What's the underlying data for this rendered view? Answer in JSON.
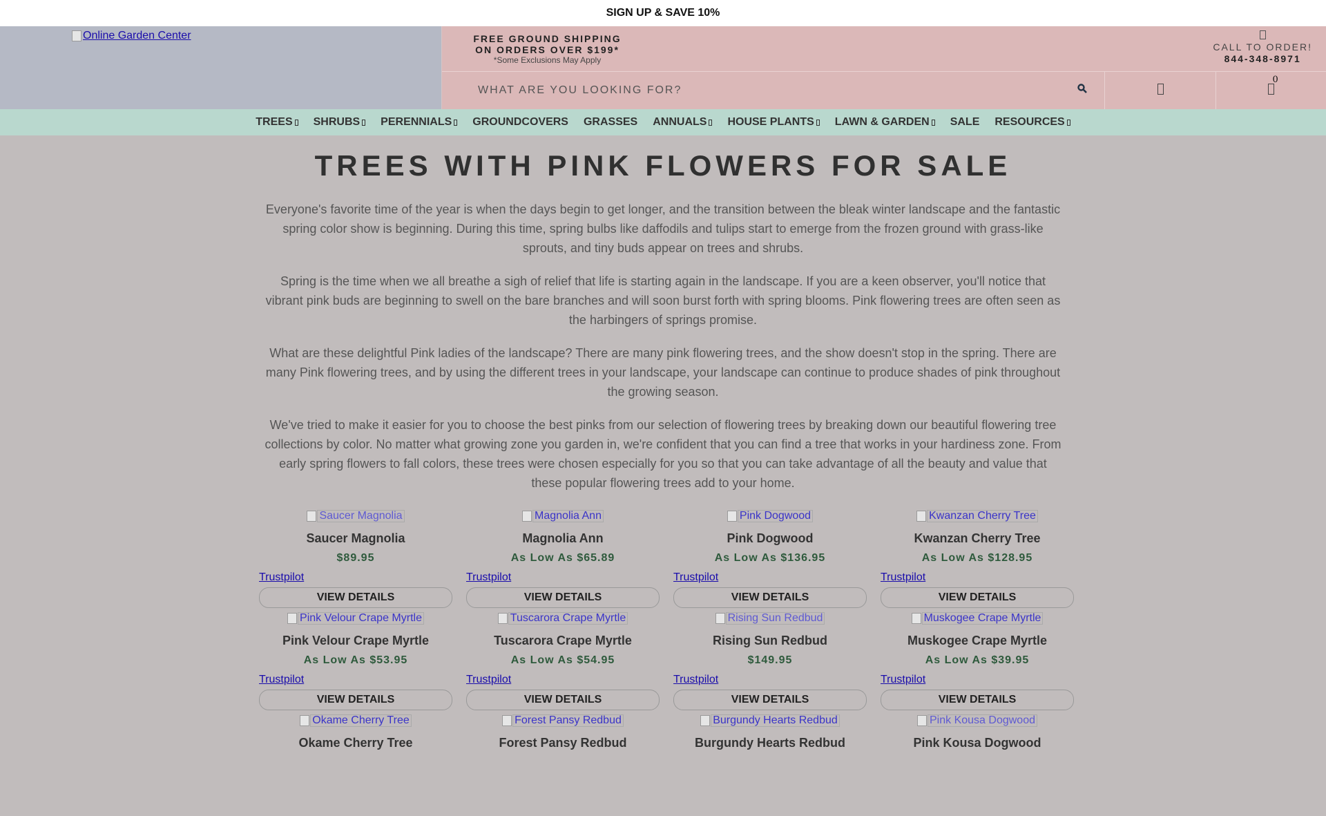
{
  "topbar": {
    "text": "SIGN UP & SAVE 10%"
  },
  "header": {
    "logo_alt": "Online Garden Center",
    "shipping_line1": "FREE GROUND SHIPPING",
    "shipping_line2": "ON ORDERS OVER $199*",
    "shipping_note": "*Some Exclusions May Apply",
    "call_label": "CALL TO ORDER!",
    "phone": "844-348-8971",
    "search_placeholder": "WHAT ARE YOU LOOKING FOR?",
    "cart_count": "0"
  },
  "nav": [
    {
      "label": "TREES",
      "dropdown": true
    },
    {
      "label": "SHRUBS",
      "dropdown": true
    },
    {
      "label": "PERENNIALS",
      "dropdown": true
    },
    {
      "label": "GROUNDCOVERS",
      "dropdown": false
    },
    {
      "label": "GRASSES",
      "dropdown": false
    },
    {
      "label": "ANNUALS",
      "dropdown": true
    },
    {
      "label": "HOUSE PLANTS",
      "dropdown": true
    },
    {
      "label": "LAWN & GARDEN",
      "dropdown": true
    },
    {
      "label": "SALE",
      "dropdown": false
    },
    {
      "label": "RESOURCES",
      "dropdown": true
    }
  ],
  "main": {
    "title": "TREES WITH PINK FLOWERS FOR SALE",
    "paragraphs": [
      "Everyone's favorite time of the year is when the days begin to get longer, and the transition between the bleak winter landscape and the fantastic spring color show is beginning. During this time, spring bulbs like daffodils and tulips start to emerge from the frozen ground with grass-like sprouts, and tiny buds appear on trees and shrubs.",
      "Spring is the time when we all breathe a sigh of relief that life is starting again in the landscape. If you are a keen observer, you'll notice that vibrant pink buds are beginning to swell on the bare branches and will soon burst forth with spring blooms. Pink flowering trees are often seen as the harbingers of springs promise.",
      "What are these delightful Pink ladies of the landscape? There are many pink flowering trees, and the show doesn't stop in the spring. There are many Pink flowering trees, and by using the different trees in your landscape, your landscape can continue to produce shades of pink throughout the growing season.",
      "We've tried to make it easier for you to choose the best pinks from our selection of flowering trees by breaking down our beautiful flowering tree collections by color. No matter what growing zone you garden in, we're confident that you can find a tree that works in your hardiness zone. From early spring flowers to fall colors, these trees were chosen especially for you so that you can take advantage of all the beauty and value that these popular flowering trees add to your home."
    ]
  },
  "products": [
    {
      "name": "Saucer Magnolia",
      "price": "$89.95",
      "trust": "Trustpilot",
      "button": "VIEW DETAILS"
    },
    {
      "name": "Magnolia Ann",
      "price": "As Low As $65.89",
      "trust": "Trustpilot",
      "button": "VIEW DETAILS"
    },
    {
      "name": "Pink Dogwood",
      "price": "As Low As $136.95",
      "trust": "Trustpilot",
      "button": "VIEW DETAILS"
    },
    {
      "name": "Kwanzan Cherry Tree",
      "price": "As Low As $128.95",
      "trust": "Trustpilot",
      "button": "VIEW DETAILS"
    },
    {
      "name": "Pink Velour Crape Myrtle",
      "price": "As Low As $53.95",
      "trust": "Trustpilot",
      "button": "VIEW DETAILS"
    },
    {
      "name": "Tuscarora Crape Myrtle",
      "price": "As Low As $54.95",
      "trust": "Trustpilot",
      "button": "VIEW DETAILS"
    },
    {
      "name": "Rising Sun Redbud",
      "price": "$149.95",
      "trust": "Trustpilot",
      "button": "VIEW DETAILS"
    },
    {
      "name": "Muskogee Crape Myrtle",
      "price": "As Low As $39.95",
      "trust": "Trustpilot",
      "button": "VIEW DETAILS"
    },
    {
      "name": "Okame Cherry Tree",
      "price": "",
      "trust": "",
      "button": ""
    },
    {
      "name": "Forest Pansy Redbud",
      "price": "",
      "trust": "",
      "button": ""
    },
    {
      "name": "Burgundy Hearts Redbud",
      "price": "",
      "trust": "",
      "button": ""
    },
    {
      "name": "Pink Kousa Dogwood",
      "price": "",
      "trust": "",
      "button": ""
    }
  ],
  "icons": {
    "search": "search-icon",
    "account": "user-icon",
    "cart": "cart-icon",
    "phone": "phone-icon",
    "dropdown": "chevron-down-icon"
  },
  "colors": {
    "topbar_bg": "#ffffff",
    "logo_bg": "#b5b9c5",
    "header_bg": "#dbb8b8",
    "nav_bg": "#b9d8ce",
    "page_bg": "#c1bcbc",
    "price": "#2e5a3c",
    "link": "#1a0dab"
  }
}
